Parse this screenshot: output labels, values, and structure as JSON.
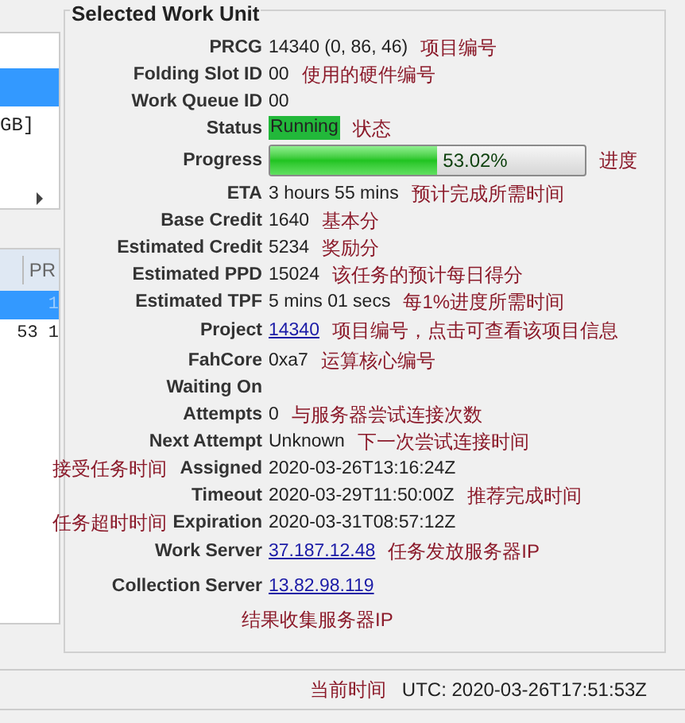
{
  "left_panel": {
    "list_rows": [
      {
        "selected": true
      },
      {
        "text": "GB]",
        "selected": false
      }
    ],
    "table": {
      "columns": [
        "PR"
      ],
      "rows": [
        {
          "text": "1",
          "selected": true
        },
        {
          "text": "53 1",
          "selected": false
        }
      ]
    }
  },
  "group": {
    "title": "Selected Work Unit",
    "rows": [
      {
        "label": "PRCG",
        "kind": "text",
        "value": "14340 (0, 86, 46)",
        "note": "项目编号"
      },
      {
        "label": "Folding Slot ID",
        "kind": "text",
        "value": "00",
        "note": "使用的硬件编号"
      },
      {
        "label": "Work Queue ID",
        "kind": "text",
        "value": "00"
      },
      {
        "label": "Status",
        "kind": "status",
        "value": "Running",
        "note": "状态"
      },
      {
        "label": "Progress",
        "kind": "progress",
        "value": "53.02%",
        "level": 0.5302,
        "note": "进度"
      },
      {
        "label": "ETA",
        "kind": "text",
        "value": "3 hours 55 mins",
        "note": "预计完成所需时间"
      },
      {
        "label": "Base Credit",
        "kind": "text",
        "value": "1640",
        "note": "基本分"
      },
      {
        "label": "Estimated Credit",
        "kind": "text",
        "value": "5234",
        "note": "奖励分"
      },
      {
        "label": "Estimated PPD",
        "kind": "text",
        "value": "15024",
        "note": "该任务的预计每日得分"
      },
      {
        "label": "Estimated TPF",
        "kind": "text",
        "value": "5 mins 01 secs",
        "note": "每1%进度所需时间"
      },
      {
        "label": "Project",
        "kind": "link",
        "value": "14340",
        "note": "项目编号，点击可查看该项目信息"
      },
      {
        "label": "FahCore",
        "kind": "text",
        "value": "0xa7",
        "note": "运算核心编号"
      },
      {
        "label": "Waiting On",
        "kind": "text"
      },
      {
        "label": "Attempts",
        "kind": "text",
        "value": "0",
        "note": "与服务器尝试连接次数"
      },
      {
        "label": "Next Attempt",
        "kind": "text",
        "value": "Unknown",
        "note": "下一次尝试连接时间"
      },
      {
        "label": "Assigned",
        "kind": "text",
        "value": "2020-03-26T13:16:24Z",
        "side_note": "接受任务时间"
      },
      {
        "label": "Timeout",
        "kind": "text",
        "value": "2020-03-29T11:50:00Z",
        "note": "推荐完成时间"
      },
      {
        "label": "Expiration",
        "kind": "text",
        "value": "2020-03-31T08:57:12Z",
        "side_note": "任务超时时间"
      },
      {
        "label": "Work Server",
        "kind": "link",
        "value": "37.187.12.48",
        "note": "任务发放服务器IP"
      },
      {
        "label": "Collection Server",
        "kind": "link",
        "value": "13.82.98.119"
      }
    ],
    "footer_note": "结果收集服务器IP"
  },
  "status_bar": {
    "note": "当前时间",
    "utc": "UTC: 2020-03-26T17:51:53Z"
  }
}
